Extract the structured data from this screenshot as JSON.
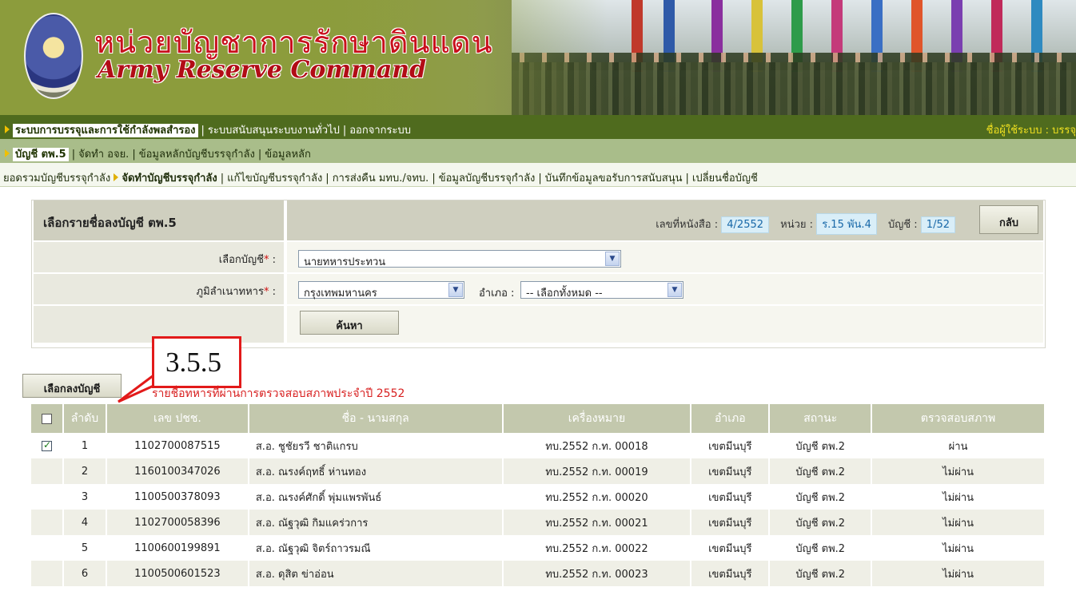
{
  "banner": {
    "title_th": "หน่วยบัญชาการรักษาดินแดน",
    "title_en": "Army Reserve Command"
  },
  "nav1": {
    "items": [
      "ระบบการบรรจุและการใช้กำลังพลสำรอง",
      "ระบบสนับสนุนระบบงานทั่วไป",
      "ออกจากระบบ"
    ],
    "user_label": "ชื่อผู้ใช้ระบบ : บรรจุ"
  },
  "nav2": {
    "items": [
      "บัญชี ตพ.5",
      "จัดทำ อจย.",
      "ข้อมูลหลักบัญชีบรรจุกำลัง",
      "ข้อมูลหลัก"
    ]
  },
  "nav3": {
    "items": [
      "ยอดรวมบัญชีบรรจุกำลัง",
      "จัดทำบัญชีบรรจุกำลัง",
      "แก้ไขบัญชีบรรจุกำลัง",
      "การส่งคืน มทบ./จทบ.",
      "ข้อมูลบัญชีบรรจุกำลัง",
      "บันทึกข้อมูลขอรับการสนับสนุน",
      "เปลี่ยนชื่อบัญชี"
    ]
  },
  "form": {
    "header_title": "เลือกรายชื่อลงบัญชี ตพ.5",
    "doc_no_label": "เลขที่หนังสือ :",
    "doc_no": "4/2552",
    "unit_label": "หน่วย :",
    "unit": "ร.15 พัน.4",
    "account_label": "บัญชี :",
    "account": "1/52",
    "back_label": "กลับ",
    "select_account_label": "เลือกบัญชี",
    "select_account_value": "นายทหารประทวน",
    "domicile_label": "ภูมิลำเนาทหาร",
    "province_value": "กรุงเทพมหานคร",
    "district_label": "อำเภอ :",
    "district_value": "-- เลือกทั้งหมด --",
    "search_label": "ค้นหา",
    "required_mark": "*",
    "colon": ":"
  },
  "callout": {
    "text": "3.5.5"
  },
  "list": {
    "select_button": "เลือกลงบัญชี",
    "title": "รายชื่อทหารที่ผ่านการตรวจสอบสภาพประจำปี 2552"
  },
  "table": {
    "headers": [
      "ลำดับ",
      "เลข ปชช.",
      "ชื่อ - นามสกุล",
      "เครื่องหมาย",
      "อำเภอ",
      "สถานะ",
      "ตรวจสอบสภาพ"
    ],
    "rows": [
      {
        "checked": true,
        "no": "1",
        "id": "1102700087515",
        "name": "ส.อ. ชูชัยรวี  ชาติแกรบ",
        "mark": "ทบ.2552 ก.ท. 00018",
        "district": "เขตมีนบุรี",
        "status": "บัญชี ตพ.2",
        "check": "ผ่าน"
      },
      {
        "checked": false,
        "no": "2",
        "id": "1160100347026",
        "name": "ส.อ. ณรงค์ฤทธิ์  ห่านทอง",
        "mark": "ทบ.2552 ก.ท. 00019",
        "district": "เขตมีนบุรี",
        "status": "บัญชี ตพ.2",
        "check": "ไม่ผ่าน"
      },
      {
        "checked": false,
        "no": "3",
        "id": "1100500378093",
        "name": "ส.อ. ณรงค์ศักดิ์  พุ่มแพรพันธ์",
        "mark": "ทบ.2552 ก.ท. 00020",
        "district": "เขตมีนบุรี",
        "status": "บัญชี ตพ.2",
        "check": "ไม่ผ่าน"
      },
      {
        "checked": false,
        "no": "4",
        "id": "1102700058396",
        "name": "ส.อ. ณัฐวุฒิ  กิมแคร่วการ",
        "mark": "ทบ.2552 ก.ท. 00021",
        "district": "เขตมีนบุรี",
        "status": "บัญชี ตพ.2",
        "check": "ไม่ผ่าน"
      },
      {
        "checked": false,
        "no": "5",
        "id": "1100600199891",
        "name": "ส.อ. ณัฐวุฒิ  จิตร์ถาวรมณี",
        "mark": "ทบ.2552 ก.ท. 00022",
        "district": "เขตมีนบุรี",
        "status": "บัญชี ตพ.2",
        "check": "ไม่ผ่าน"
      },
      {
        "checked": false,
        "no": "6",
        "id": "1100500601523",
        "name": "ส.อ. ดุสิต  ข่าอ่อน",
        "mark": "ทบ.2552 ก.ท. 00023",
        "district": "เขตมีนบุรี",
        "status": "บัญชี ตพ.2",
        "check": "ไม่ผ่าน"
      }
    ]
  },
  "colors": {
    "nav1_bg": "#4f6b1e",
    "nav2_bg": "#a9bd8a",
    "title_red": "#c8101c",
    "callout_red": "#e21a1a",
    "info_blue": "#1868a8"
  }
}
